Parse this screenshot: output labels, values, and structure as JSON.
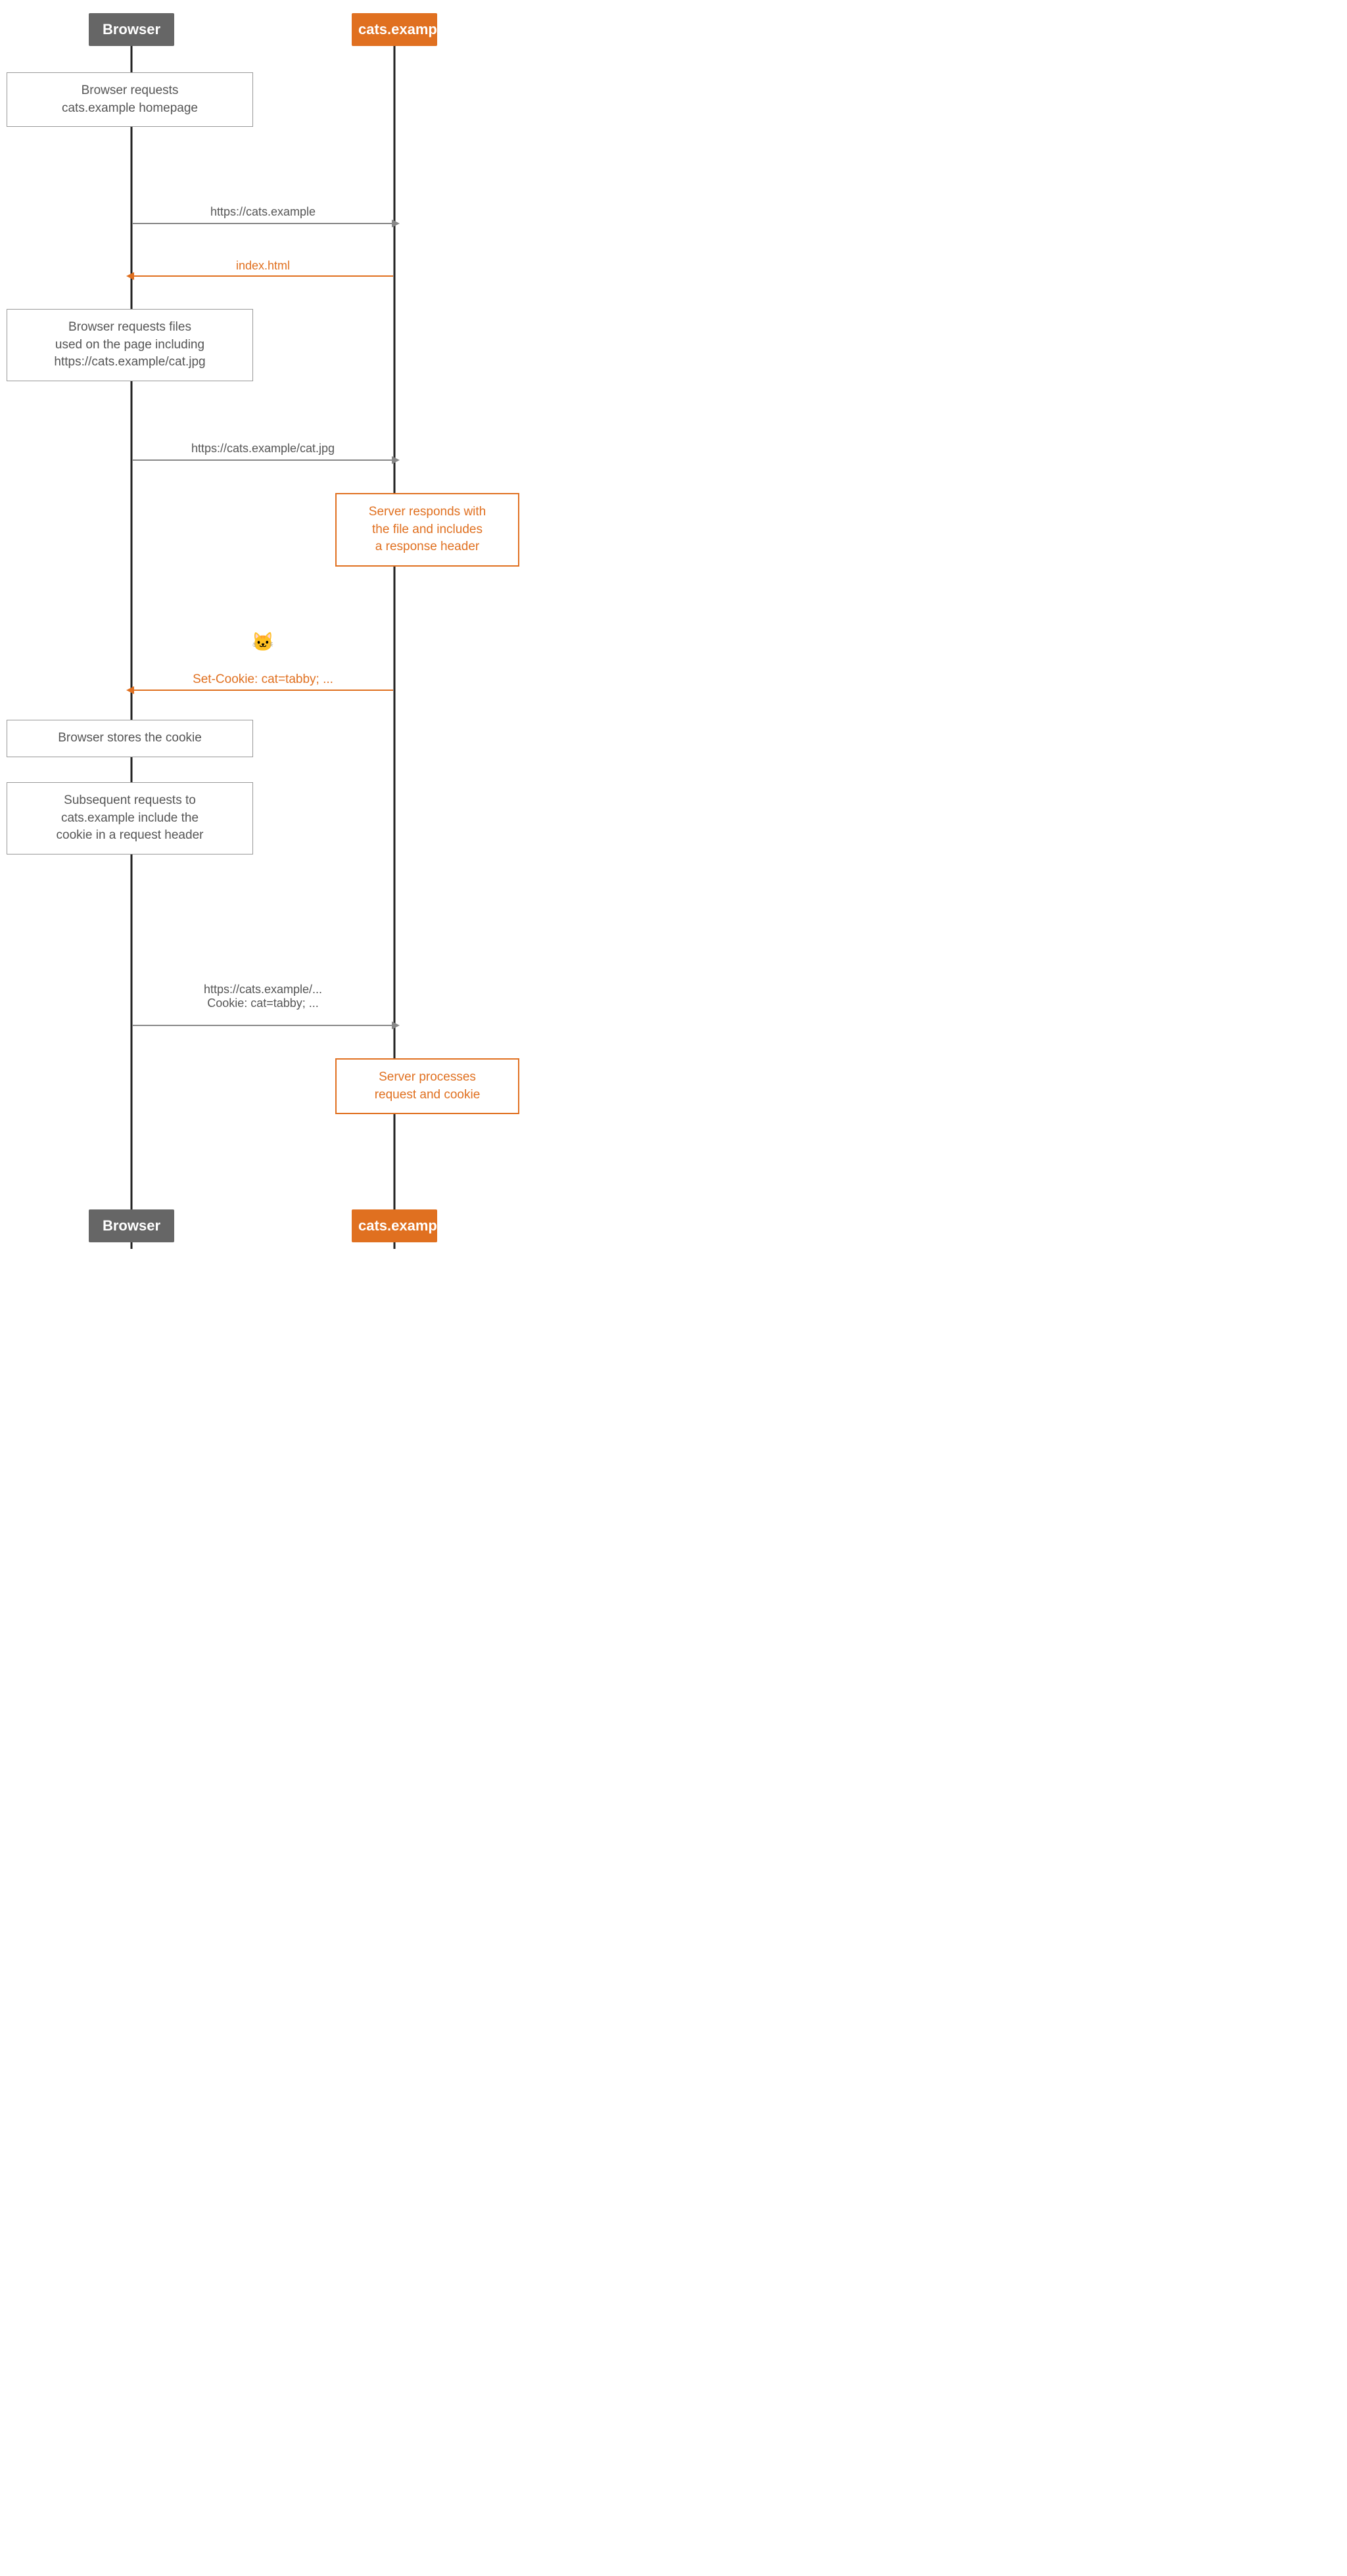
{
  "actors": {
    "browser_label": "Browser",
    "server_label": "cats.example"
  },
  "messages": {
    "browser_requests_homepage": "Browser requests\ncats.example homepage",
    "browser_requests_files": "Browser requests files\nused on the page including\nhttps://cats.example/cat.jpg",
    "server_responds": "Server responds with\nthe file and includes\na response header",
    "browser_stores_cookie": "Browser stores the cookie",
    "subsequent_requests": "Subsequent requests to\ncats.example include the\ncookie in a request header",
    "server_processes": "Server processes\nrequest and cookie"
  },
  "arrows": {
    "req1_url": "https://cats.example",
    "resp1_label": "index.html",
    "req2_url": "https://cats.example/cat.jpg",
    "cookie_emoji": "🐱",
    "set_cookie": "Set-Cookie: cat=tabby; ...",
    "req3_line1": "https://cats.example/...",
    "req3_line2": "Cookie: cat=tabby; ..."
  },
  "colors": {
    "browser_bg": "#666666",
    "server_bg": "#e07020",
    "box_border": "#999999",
    "server_box_border": "#e07020",
    "arrow_color": "#888888",
    "orange": "#e07020",
    "text_gray": "#555555"
  }
}
